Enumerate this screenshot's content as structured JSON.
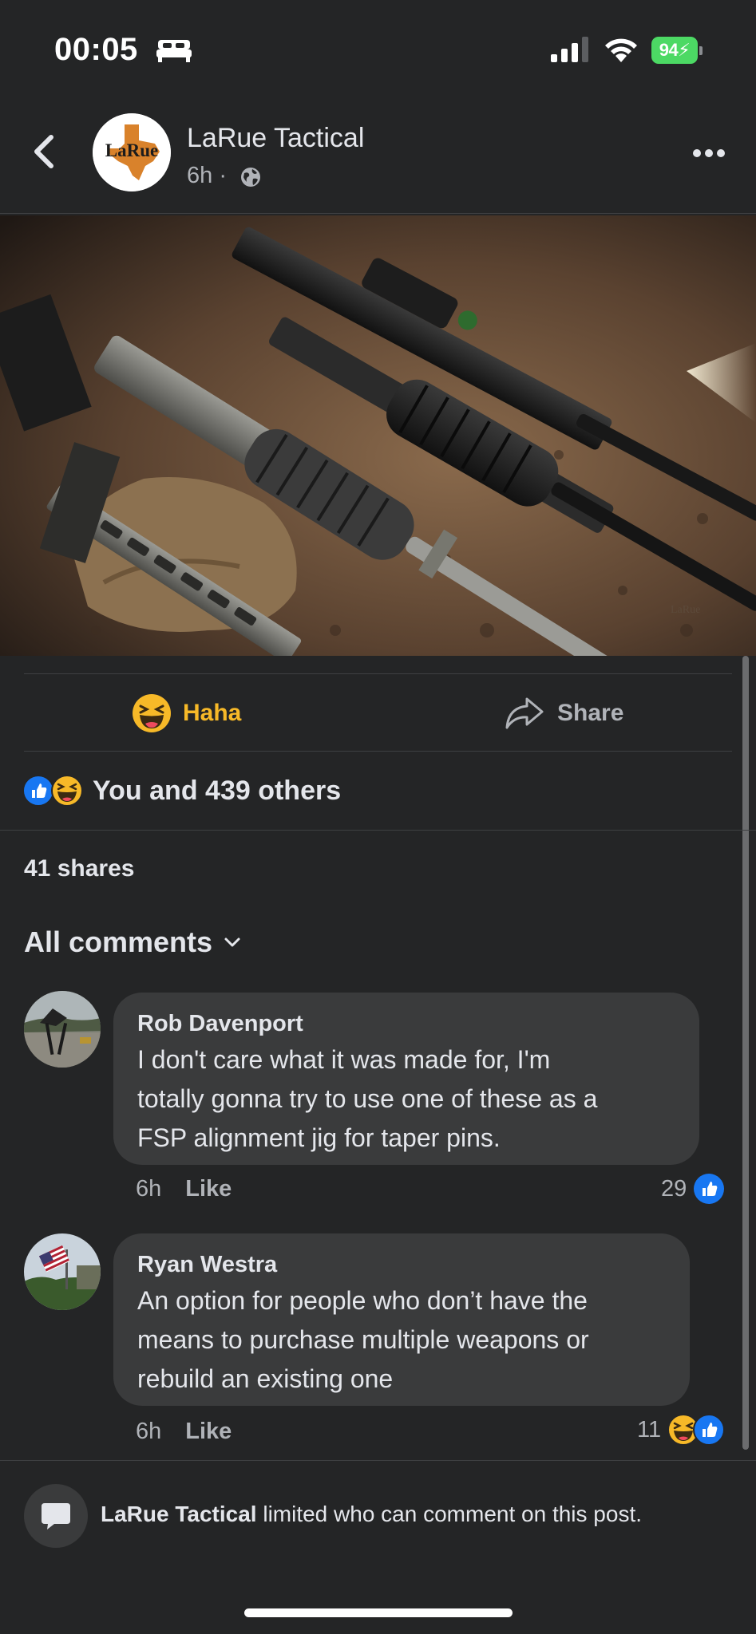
{
  "status_bar": {
    "time": "00:05",
    "battery": "94"
  },
  "header": {
    "page_name": "LaRue Tactical",
    "avatar_text": "LaRue",
    "post_time": "6h ·"
  },
  "actions": {
    "haha_label": "Haha",
    "share_label": "Share"
  },
  "reactions": {
    "summary": "You and 439 others"
  },
  "shares": "41 shares",
  "comments_section": {
    "filter_label": "All comments"
  },
  "comments": [
    {
      "name": "Rob Davenport",
      "lines": [
        "I don't care what it was made for, I'm",
        "totally gonna try to use one of these as a",
        "FSP alignment jig for taper pins."
      ],
      "time": "6h",
      "like_label": "Like",
      "reaction_count": "29"
    },
    {
      "name": "Ryan Westra",
      "lines": [
        "An option for people who don’t have the",
        "means to purchase multiple weapons or",
        "rebuild an existing one"
      ],
      "time": "6h",
      "like_label": "Like",
      "reaction_count": "11"
    }
  ],
  "footer": {
    "page_name": "LaRue Tactical",
    "notice": " limited who can comment on this post."
  },
  "colors": {
    "background": "#242526",
    "bubble": "#3a3b3c",
    "haha_yellow": "#f7b928",
    "like_blue": "#1877f2",
    "battery_green": "#4cd964"
  }
}
